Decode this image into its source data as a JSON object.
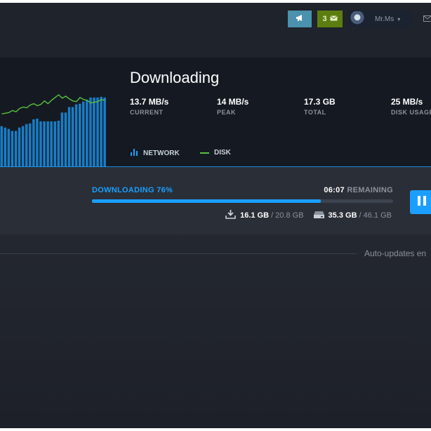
{
  "header": {
    "notifications_count": "3",
    "username": "Mr.Ms",
    "icons": [
      "megaphone-icon",
      "envelope-icon",
      "chevron-down-icon",
      "mail-icon"
    ],
    "colors": {
      "announce_bg": "#4a92ad",
      "notif_bg": "#5c7e10"
    }
  },
  "download": {
    "title": "Downloading",
    "stats": [
      {
        "value": "13.7 MB/s",
        "label": "CURRENT"
      },
      {
        "value": "14 MB/s",
        "label": "PEAK"
      },
      {
        "value": "17.3 GB",
        "label": "TOTAL"
      },
      {
        "value": "25 MB/s",
        "label": "DISK USAGE"
      }
    ],
    "legend": {
      "network": "NETWORK",
      "disk": "DISK"
    },
    "colors": {
      "network": "#1a9fff",
      "disk": "#59bf40"
    }
  },
  "chart_data": {
    "type": "bar",
    "series": [
      {
        "values": [
          6,
          5.8,
          5.6,
          5.3,
          5.3,
          5.8,
          6,
          6.3,
          6.4,
          7,
          7.1,
          6.7,
          6.7,
          6.7,
          6.7,
          6.7,
          6.8,
          8,
          8,
          8.8,
          8.8,
          9.2,
          9.3,
          9.6,
          9.8,
          10.2,
          10.2,
          10.2,
          10.3,
          10.2
        ]
      },
      {
        "type": "line",
        "values": [
          7.8,
          7.9,
          8.0,
          8.3,
          8.1,
          8.6,
          8.8,
          8.7,
          9.1,
          9.3,
          9.0,
          9.2,
          9.7,
          9.3,
          9.8,
          10.2,
          10.6,
          10.1,
          10.4,
          10.0,
          9.7,
          9.6,
          10.2,
          9.9,
          9.8,
          9.4,
          9.5,
          9.6,
          9.9,
          9.8
        ]
      }
    ]
  },
  "progress": {
    "label": "DOWNLOADING 76%",
    "percent": 0.76,
    "time": "06:07",
    "remaining_label": "REMAINING",
    "download_current": "16.1 GB",
    "download_total": "/ 20.8 GB",
    "disk_current": "35.3 GB",
    "disk_total": "/ 46.1 GB"
  },
  "footer": {
    "auto_updates": "Auto-updates en"
  }
}
